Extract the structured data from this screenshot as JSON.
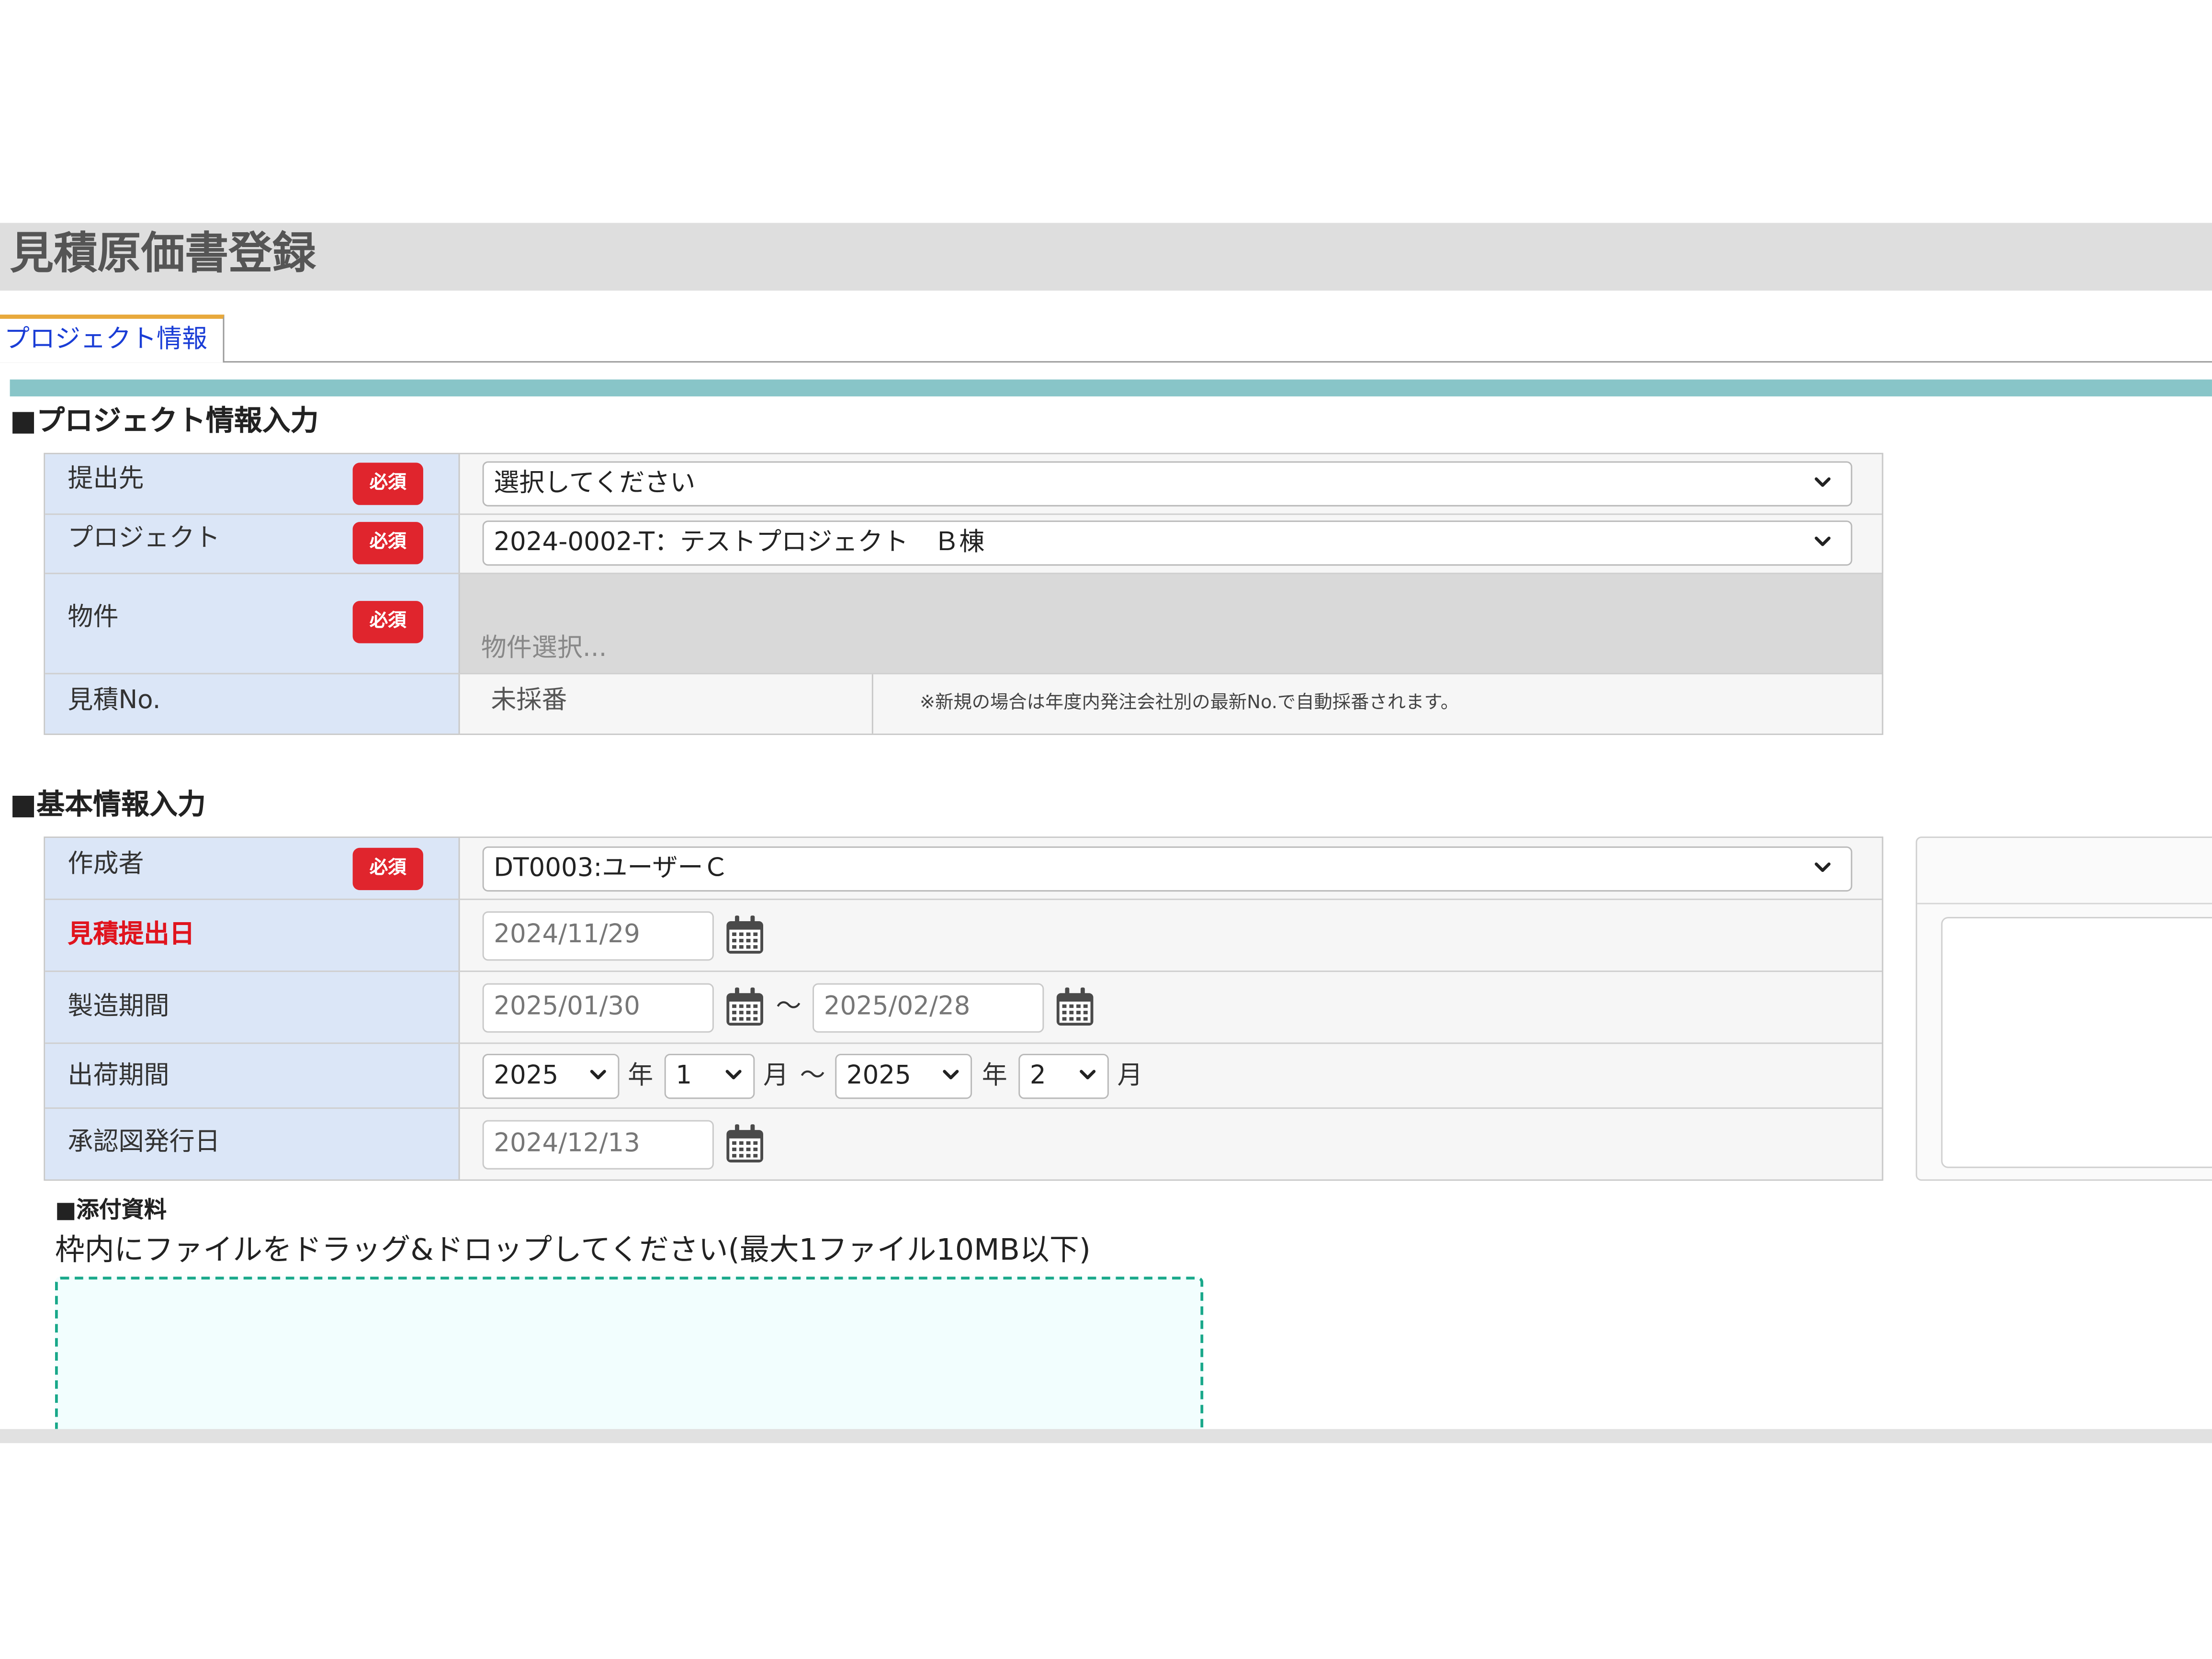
{
  "page": {
    "title": "見積原価書登録"
  },
  "tabs": [
    {
      "label": "プロジェクト情報",
      "active": true
    }
  ],
  "colors": {
    "accent_tab": "#e8a93c",
    "teal_bar": "#88c5c8",
    "required": "#e0252d",
    "label_bg": "#dbe6f7",
    "drop_border": "#19a88a"
  },
  "project_section": {
    "heading": "■プロジェクト情報入力",
    "required_badge": "必須",
    "submit_to": {
      "label": "提出先",
      "value": "選択してください"
    },
    "project": {
      "label": "プロジェクト",
      "value": "2024-0002-T：テストプロジェクト　Ｂ棟"
    },
    "property": {
      "label": "物件",
      "placeholder": "物件選択..."
    },
    "estimate_no": {
      "label": "見積No.",
      "value": "未採番",
      "note": "※新規の場合は年度内発注会社別の最新No.で自動採番されます。"
    }
  },
  "basic_section": {
    "heading": "■基本情報入力",
    "author": {
      "label": "作成者",
      "value": "DT0003:ユーザーＣ"
    },
    "submission_date": {
      "label": "見積提出日",
      "value": "2024/11/29"
    },
    "manufacturing_period": {
      "label": "製造期間",
      "from": "2025/01/30",
      "separator": "～",
      "to": "2025/02/28"
    },
    "shipping_period": {
      "label": "出荷期間",
      "from_year": "2025",
      "year_unit": "年",
      "from_month": "1",
      "month_unit": "月",
      "separator": "～",
      "to_year": "2025",
      "to_month": "2"
    },
    "approval_drawing_date": {
      "label": "承認図発行日",
      "value": "2024/12/13"
    }
  },
  "attachments": {
    "heading": "■添付資料",
    "instruction": "枠内にファイルをドラッグ&ドロップしてください(最大1ファイル10MB以下)"
  }
}
